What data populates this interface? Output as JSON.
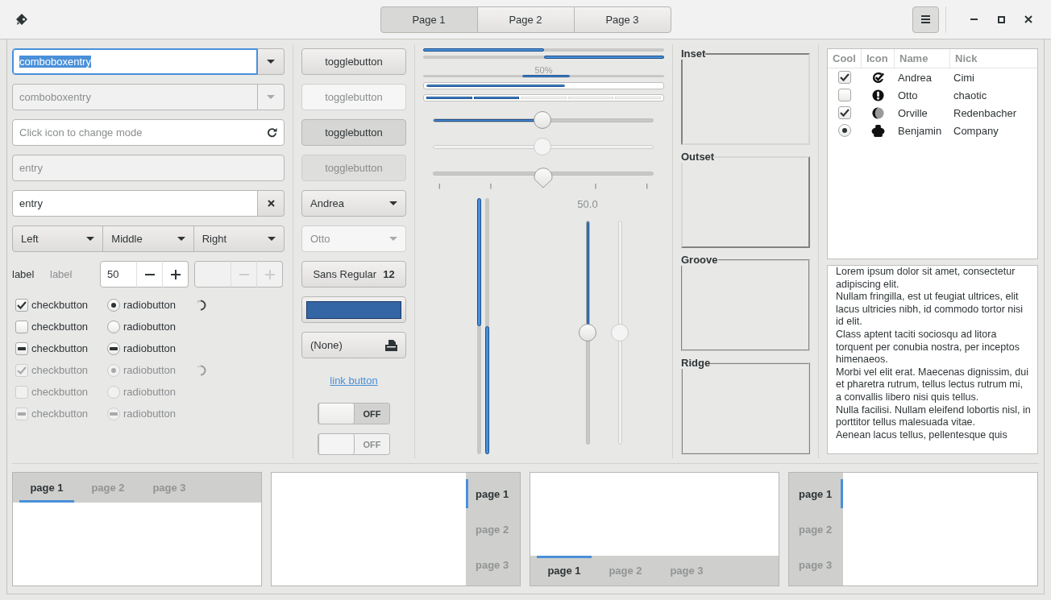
{
  "header": {
    "tabs": [
      {
        "label": "Page 1",
        "selected": true
      },
      {
        "label": "Page 2",
        "selected": false
      },
      {
        "label": "Page 3",
        "selected": false
      }
    ]
  },
  "combo_entries": [
    {
      "value": "comboboxentry",
      "focused": true,
      "text_selected": true,
      "disabled": false
    },
    {
      "value": "comboboxentry",
      "focused": false,
      "text_selected": false,
      "disabled": true
    }
  ],
  "entries": [
    {
      "kind": "icon",
      "placeholder": "Click icon to change mode",
      "disabled": false
    },
    {
      "kind": "plain",
      "value": "entry",
      "disabled": true
    },
    {
      "kind": "clear",
      "value": "entry",
      "disabled": false
    }
  ],
  "linked_combos": [
    {
      "label": "Left"
    },
    {
      "label": "Middle"
    },
    {
      "label": "Right"
    }
  ],
  "labels": [
    {
      "text": "label",
      "disabled": false
    },
    {
      "text": "label",
      "disabled": true
    }
  ],
  "spin_buttons": [
    {
      "value": "50",
      "disabled": false
    },
    {
      "disabled": true
    }
  ],
  "check_rows": [
    {
      "check": {
        "kind": "plain",
        "checked": true,
        "label": "checkbutton"
      },
      "radio": {
        "kind": "plain",
        "selected": true,
        "label": "radiobutton"
      },
      "spinner": true,
      "disabled": false
    },
    {
      "check": {
        "kind": "plain",
        "checked": false,
        "label": "checkbutton"
      },
      "radio": {
        "kind": "plain",
        "selected": false,
        "label": "radiobutton"
      },
      "spinner": false,
      "disabled": false
    },
    {
      "check": {
        "kind": "mixed",
        "label": "checkbutton"
      },
      "radio": {
        "kind": "mixed",
        "label": "radiobutton"
      },
      "spinner": false,
      "disabled": false
    },
    {
      "check": {
        "kind": "plain",
        "checked": true,
        "label": "checkbutton"
      },
      "radio": {
        "kind": "plain",
        "selected": true,
        "label": "radiobutton"
      },
      "spinner": true,
      "disabled": true
    },
    {
      "check": {
        "kind": "plain",
        "checked": false,
        "label": "checkbutton"
      },
      "radio": {
        "kind": "plain",
        "selected": false,
        "label": "radiobutton"
      },
      "spinner": false,
      "disabled": true
    },
    {
      "check": {
        "kind": "mixed",
        "label": "checkbutton"
      },
      "radio": {
        "kind": "mixed",
        "label": "radiobutton"
      },
      "spinner": false,
      "disabled": true
    }
  ],
  "toggle_buttons": [
    {
      "label": "togglebutton",
      "active": false,
      "disabled": false
    },
    {
      "label": "togglebutton",
      "active": false,
      "disabled": true
    },
    {
      "label": "togglebutton",
      "active": true,
      "disabled": false
    },
    {
      "label": "togglebutton",
      "active": true,
      "disabled": true
    }
  ],
  "combos": [
    {
      "value": "Andrea",
      "disabled": false
    },
    {
      "value": "Otto",
      "disabled": true
    }
  ],
  "font_button": {
    "family": "Sans Regular",
    "size": "12"
  },
  "color_button": {
    "color": "#3465a4"
  },
  "file_button": {
    "label": "(None)"
  },
  "link_button": {
    "label": "link button"
  },
  "switches": [
    {
      "label": "OFF",
      "on": false,
      "disabled": false
    },
    {
      "label": "OFF",
      "on": false,
      "disabled": true
    }
  ],
  "progress_bars": [
    {
      "kind": "bar",
      "level": 0.5
    },
    {
      "kind": "inverted",
      "level": 0.5
    },
    {
      "kind": "activity",
      "text": "50%"
    },
    {
      "kind": "boxed",
      "level": 0.59
    },
    {
      "kind": "segmented",
      "level": 0.4
    }
  ],
  "sliders": [
    {
      "kind": "fill",
      "level": 0.5,
      "disabled": false
    },
    {
      "kind": "plain",
      "level": 0.5,
      "disabled": true
    },
    {
      "kind": "marks",
      "level": 0.5,
      "disabled": false
    }
  ],
  "vertical_progress": [
    {
      "level": 0.5,
      "inverted": false
    },
    {
      "level": 0.5,
      "inverted": true
    }
  ],
  "vertical_sliders": [
    {
      "level": 0.5,
      "disabled": false,
      "value": "50.0"
    },
    {
      "level": 0.5,
      "disabled": true
    }
  ],
  "frames": [
    {
      "label": "Inset",
      "kind": "inset"
    },
    {
      "label": "Outset",
      "kind": "outset"
    },
    {
      "label": "Groove",
      "kind": "groove"
    },
    {
      "label": "Ridge",
      "kind": "ridge"
    }
  ],
  "tree": {
    "columns": [
      "Cool",
      "Icon",
      "Name",
      "Nick"
    ],
    "rows": [
      {
        "cool": {
          "kind": "check",
          "checked": true
        },
        "name": "Andrea",
        "nick": "Cimi"
      },
      {
        "cool": {
          "kind": "check",
          "checked": false
        },
        "name": "Otto",
        "nick": "chaotic"
      },
      {
        "cool": {
          "kind": "check",
          "checked": true
        },
        "name": "Orville",
        "nick": "Redenbacher"
      },
      {
        "cool": {
          "kind": "radio",
          "checked": true
        },
        "name": "Benjamin",
        "nick": "Company"
      }
    ]
  },
  "text_view": {
    "paragraphs": [
      "Lorem ipsum dolor sit amet, consectetur adipiscing elit.",
      "Nullam fringilla, est ut feugiat ultrices, elit lacus ultricies nibh, id commodo tortor nisi id elit.",
      "Class aptent taciti sociosqu ad litora torquent per conubia nostra, per inceptos himenaeos.",
      "Morbi vel elit erat. Maecenas dignissim, dui et pharetra rutrum, tellus lectus rutrum mi, a convallis libero nisi quis tellus.",
      "Nulla facilisi. Nullam eleifend lobortis nisl, in porttitor tellus malesuada vitae.",
      "Aenean lacus tellus, pellentesque quis"
    ]
  },
  "notebooks": [
    {
      "kind": "top",
      "tabs": [
        {
          "label": "page 1",
          "selected": true
        },
        {
          "label": "page 2",
          "selected": false
        },
        {
          "label": "page 3",
          "selected": false
        }
      ]
    },
    {
      "kind": "right",
      "tabs": [
        {
          "label": "page 1",
          "selected": true
        },
        {
          "label": "page 2",
          "selected": false
        },
        {
          "label": "page 3",
          "selected": false
        }
      ]
    },
    {
      "kind": "bottom",
      "tabs": [
        {
          "label": "page 1",
          "selected": true
        },
        {
          "label": "page 2",
          "selected": false
        },
        {
          "label": "page 3",
          "selected": false
        }
      ]
    },
    {
      "kind": "left",
      "tabs": [
        {
          "label": "page 1",
          "selected": true
        },
        {
          "label": "page 2",
          "selected": false
        },
        {
          "label": "page 3",
          "selected": false
        }
      ]
    }
  ]
}
